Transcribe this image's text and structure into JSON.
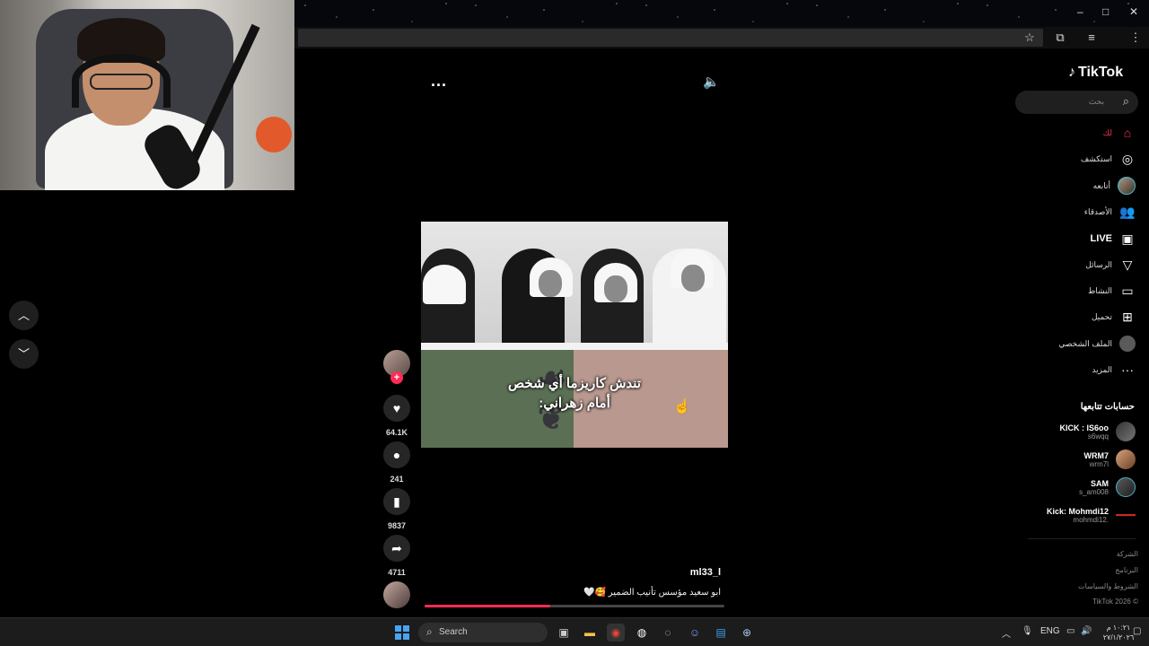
{
  "browser": {
    "window_controls": [
      "–",
      "□",
      "✕"
    ],
    "toolbar_icons": [
      "star-icon",
      "extensions-icon",
      "media-icon",
      "menu-icon"
    ]
  },
  "feed": {
    "more_label": "...",
    "caption_line1": "تندش كاريزما أي شخص",
    "caption_line2": "أمام زهراني:",
    "likes": "64.1K",
    "comments": "241",
    "saves": "9837",
    "shares": "4711",
    "author": "ml33_l",
    "description": "ابو سعيد مؤسس تأنيب الضمير 🥰🤍",
    "progress": 0.42
  },
  "sidebar": {
    "logo": "TikTok",
    "search_placeholder": "بحث",
    "items": [
      {
        "label": "لك",
        "icon": "home-icon"
      },
      {
        "label": "استكشف",
        "icon": "compass-icon"
      },
      {
        "label": "أتابعه",
        "icon": "following-avatar"
      },
      {
        "label": "الأصدقاء",
        "icon": "friends-icon"
      },
      {
        "label": "LIVE",
        "icon": "live-icon"
      },
      {
        "label": "الرسائل",
        "icon": "messages-icon"
      },
      {
        "label": "النشاط",
        "icon": "activity-icon"
      },
      {
        "label": "تحميل",
        "icon": "upload-icon"
      },
      {
        "label": "الملف الشخصي",
        "icon": "profile-icon"
      },
      {
        "label": "المزيد",
        "icon": "more-icon"
      }
    ],
    "following_title": "حسابات تتابعها",
    "following": [
      {
        "name": "KICK : IS6oo",
        "handle": "s6wqq"
      },
      {
        "name": "WRM7",
        "handle": "wrm7l"
      },
      {
        "name": "SAM",
        "handle": "s_am008"
      },
      {
        "name": "Kick: Mohmdi12",
        "handle": "mohmdi12."
      }
    ],
    "footer": [
      "الشركة",
      "البرنامج",
      "الشروط والسياسات",
      "© 2026 TikTok"
    ]
  },
  "taskbar": {
    "search_label": "Search",
    "language": "ENG",
    "clock_time": "١٠:٢١ م",
    "clock_date": "٢٧/١/٢٠٢٦"
  }
}
